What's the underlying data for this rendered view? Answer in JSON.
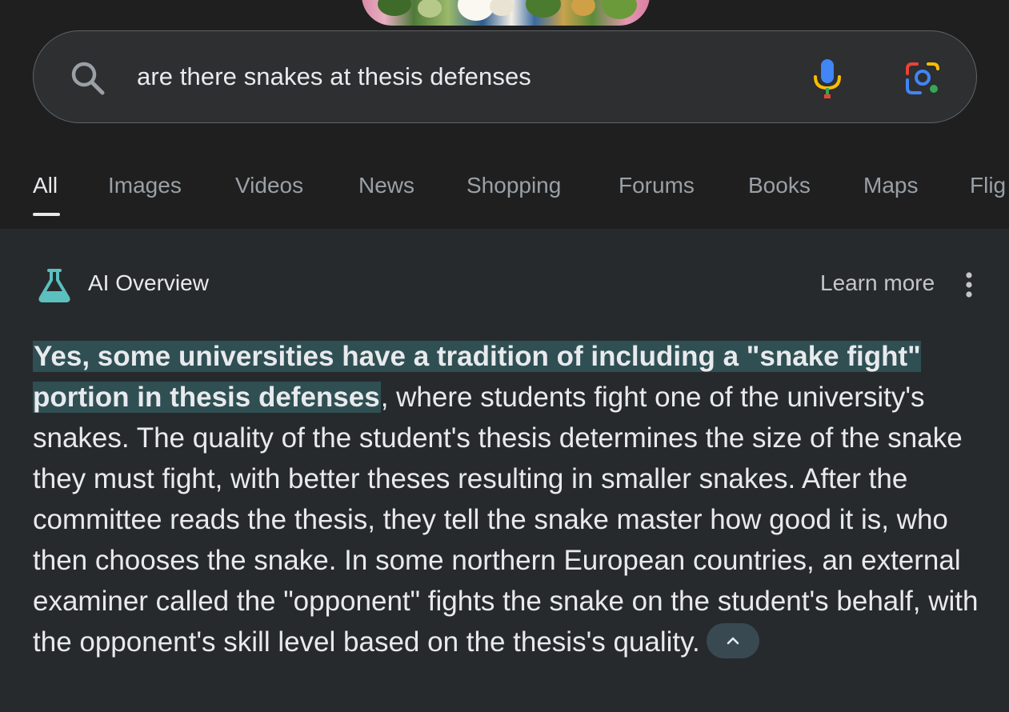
{
  "search": {
    "query": "are there snakes at thesis defenses"
  },
  "tabs": [
    {
      "label": "All",
      "active": true
    },
    {
      "label": "Images"
    },
    {
      "label": "Videos"
    },
    {
      "label": "News"
    },
    {
      "label": "Shopping"
    },
    {
      "label": "Forums"
    },
    {
      "label": "Books"
    },
    {
      "label": "Maps"
    },
    {
      "label": "Flig"
    }
  ],
  "overview": {
    "title": "AI Overview",
    "learn_more": "Learn more",
    "highlight": "Yes, some universities have a tradition of including a \"snake fight\" portion in thesis defenses",
    "body": ", where students fight one of the university's snakes. The quality of the student's thesis determines the size of the snake they must fight, with better theses resulting in smaller snakes. After the committee reads the thesis, they tell the snake master how good it is, who then chooses the snake. In some northern European countries, an external examiner called the \"opponent\" fights the snake on the student's behalf, with the opponent's skill level based on the thesis's quality."
  },
  "colors": {
    "background": "#1f1f1f",
    "panel": "#272a2d",
    "highlight": "#2f4f53",
    "accent_teal": "#5bc0be"
  },
  "icons": [
    "search-icon",
    "mic-icon",
    "lens-icon",
    "flask-icon",
    "more-vert-icon",
    "chevron-up-icon"
  ]
}
